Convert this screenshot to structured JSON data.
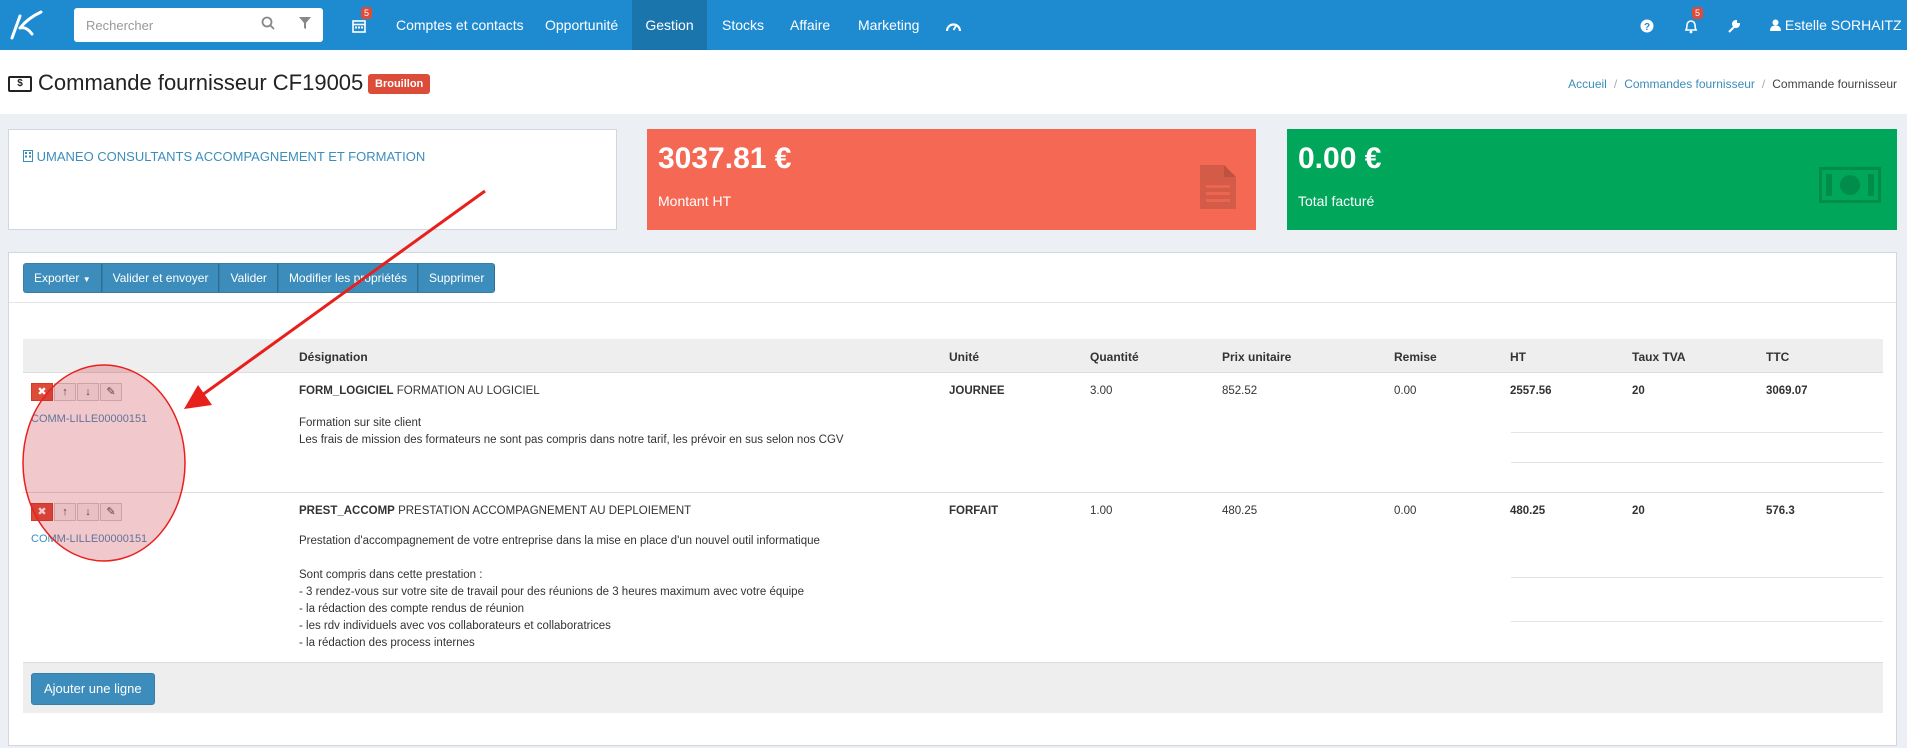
{
  "nav": {
    "search_placeholder": "Rechercher",
    "calendar_badge": "5",
    "items": [
      "Comptes et contacts",
      "Opportunité",
      "Gestion",
      "Stocks",
      "Affaire",
      "Marketing"
    ],
    "notifications_badge": "5",
    "user_name": "Estelle SORHAITZ"
  },
  "header": {
    "title": "Commande fournisseur CF19005",
    "money_glyph": "$",
    "status": "Brouillon",
    "breadcrumb": [
      "Accueil",
      "Commandes fournisseur",
      "Commande fournisseur"
    ]
  },
  "supplier": {
    "name": "UMANEO CONSULTANTS ACCOMPAGNEMENT ET FORMATION"
  },
  "cards": {
    "amount_ht": {
      "value": "3037.81 €",
      "label": "Montant HT"
    },
    "invoiced": {
      "value": "0.00 €",
      "label": "Total facturé"
    }
  },
  "toolbar": [
    "Exporter",
    "Valider et envoyer",
    "Valider",
    "Modifier les propriétés",
    "Supprimer"
  ],
  "table": {
    "headers": [
      "Désignation",
      "Unité",
      "Quantité",
      "Prix unitaire",
      "Remise",
      "HT",
      "Taux TVA",
      "TTC"
    ],
    "rows": [
      {
        "ref": "COMM-LILLE00000151",
        "code": "FORM_LOGICIEL",
        "name": "FORMATION AU LOGICIEL",
        "description": "Formation sur site client\nLes frais de mission des formateurs ne sont pas compris dans notre tarif, les prévoir en sus selon nos CGV",
        "unit": "JOURNEE",
        "quantity": "3.00",
        "unit_price": "852.52",
        "discount": "0.00",
        "ht": "2557.56",
        "tva": "20",
        "ttc": "3069.07"
      },
      {
        "ref": "COMM-LILLE00000151",
        "code": "PREST_ACCOMP",
        "name": "PRESTATION ACCOMPAGNEMENT AU DEPLOIEMENT",
        "description": "Prestation d'accompagnement de votre entreprise dans la mise en place d'un nouvel outil informatique\n\nSont compris dans cette prestation :\n- 3 rendez-vous sur votre site de travail pour des réunions de 3 heures maximum avec votre équipe\n- la rédaction des compte rendus de réunion\n- les rdv individuels avec vos collaborateurs et collaboratrices\n- la rédaction des process internes",
        "unit": "FORFAIT",
        "quantity": "1.00",
        "unit_price": "480.25",
        "discount": "0.00",
        "ht": "480.25",
        "tva": "20",
        "ttc": "576.3"
      }
    ]
  },
  "add_line_label": "Ajouter une ligne",
  "annotation": {
    "color": "#e8201c"
  },
  "colors": {
    "nav": "#1e8bd1",
    "red_card": "#f56954",
    "green_card": "#00a65a",
    "button": "#3c8dbc"
  }
}
